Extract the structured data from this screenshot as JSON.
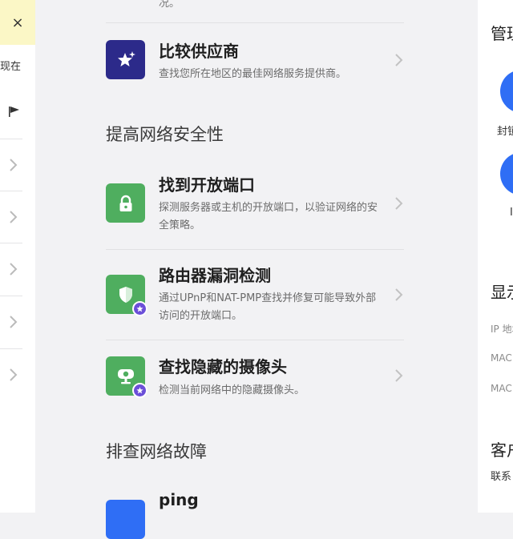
{
  "left_panel": {
    "close_icon": "×",
    "partial_text": "现在"
  },
  "main": {
    "prev_partial_text": "况。",
    "items": [
      {
        "title": "比较供应商",
        "desc": "查找您所在地区的最佳网络服务提供商。",
        "icon": "star-sparkle-icon"
      },
      {
        "title": "找到开放端口",
        "desc": "探测服务器或主机的开放端口，以验证网络的安全策略。",
        "icon": "lock-icon"
      },
      {
        "title": "路由器漏洞检测",
        "desc": "通过UPnP和NAT-PMP查找并修复可能导致外部访问的开放端口。",
        "icon": "shield-icon"
      },
      {
        "title": "查找隐藏的摄像头",
        "desc": "检测当前网络中的隐藏摄像头。",
        "icon": "camera-icon"
      },
      {
        "title": "ping",
        "icon": "ping-icon"
      }
    ],
    "sections": [
      "提高网络安全性",
      "排查网络故障"
    ]
  },
  "right_panel": {
    "heading1": "管理",
    "label1": "封锁",
    "label2": "I",
    "heading2": "显示",
    "row1": "IP 地址",
    "row2": "MAC",
    "row3": "MAC",
    "heading3": "客户",
    "row4": "联系"
  },
  "colors": {
    "purple": "#2c2a8a",
    "green": "#4fae5f",
    "blue": "#2f6ef5",
    "badge": "#6b4fd8"
  }
}
